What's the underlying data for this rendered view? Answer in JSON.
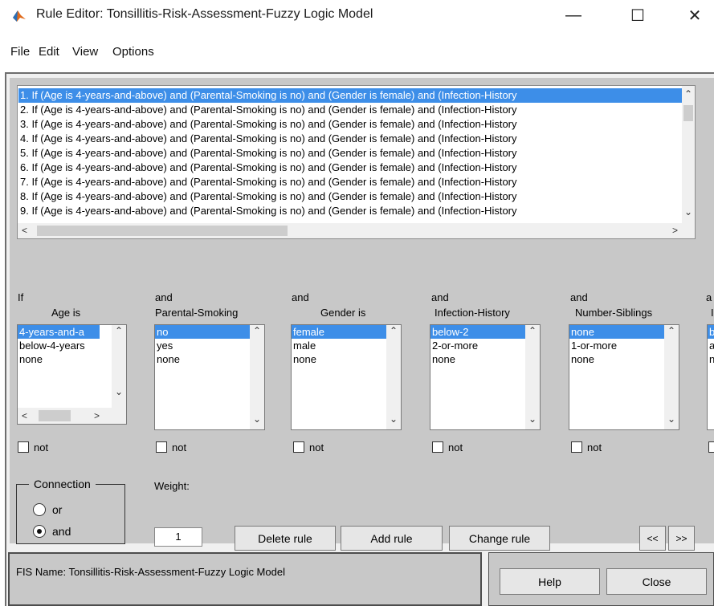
{
  "window": {
    "title": "Rule Editor: Tonsillitis-Risk-Assessment-Fuzzy Logic Model",
    "minimize": "—",
    "maximize": "☐",
    "close": "✕"
  },
  "menu": [
    "File",
    "Edit",
    "View",
    "Options"
  ],
  "rules": [
    "1. If (Age is 4-years-and-above) and (Parental-Smoking is no) and (Gender is female) and (Infection-History",
    "2. If (Age is 4-years-and-above) and (Parental-Smoking is no) and (Gender is female) and (Infection-History",
    "3. If (Age is 4-years-and-above) and (Parental-Smoking is no) and (Gender is female) and (Infection-History",
    "4. If (Age is 4-years-and-above) and (Parental-Smoking is no) and (Gender is female) and (Infection-History",
    "5. If (Age is 4-years-and-above) and (Parental-Smoking is no) and (Gender is female) and (Infection-History",
    "6. If (Age is 4-years-and-above) and (Parental-Smoking is no) and (Gender is female) and (Infection-History",
    "7. If (Age is 4-years-and-above) and (Parental-Smoking is no) and (Gender is female) and (Infection-History",
    "8. If (Age is 4-years-and-above) and (Parental-Smoking is no) and (Gender is female) and (Infection-History",
    "9. If (Age is 4-years-and-above) and (Parental-Smoking is no) and (Gender is female) and (Infection-History"
  ],
  "scroll_arrows": {
    "up": "⌃",
    "down": "⌄",
    "left": "<",
    "right": ">"
  },
  "inputs": [
    {
      "connector": "If",
      "label": "Age is",
      "options": [
        "4-years-and-a",
        "below-4-years",
        "none"
      ],
      "not_label": "not"
    },
    {
      "connector": "and",
      "label": "Parental-Smoking",
      "options": [
        "no",
        "yes",
        "none"
      ],
      "not_label": "not"
    },
    {
      "connector": "and",
      "label": "Gender is",
      "options": [
        "female",
        "male",
        "none"
      ],
      "not_label": "not"
    },
    {
      "connector": "and",
      "label": "Infection-History",
      "options": [
        "below-2",
        "2-or-more",
        "none"
      ],
      "not_label": "not"
    },
    {
      "connector": "and",
      "label": "Number-Siblings",
      "options": [
        "none",
        "1-or-more",
        "none"
      ],
      "not_label": "not"
    },
    {
      "connector": "a",
      "label": "I",
      "options": [
        "b",
        "a",
        "n"
      ],
      "not_label": ""
    }
  ],
  "connection": {
    "title": "Connection",
    "or_label": "or",
    "and_label": "and",
    "selected": "and"
  },
  "weight": {
    "label": "Weight:",
    "value": "1"
  },
  "buttons": {
    "delete": "Delete rule",
    "add": "Add rule",
    "change": "Change rule",
    "prev": "<<",
    "next": ">>",
    "help": "Help",
    "close": "Close"
  },
  "status": "FIS Name: Tonsillitis-Risk-Assessment-Fuzzy Logic Model"
}
